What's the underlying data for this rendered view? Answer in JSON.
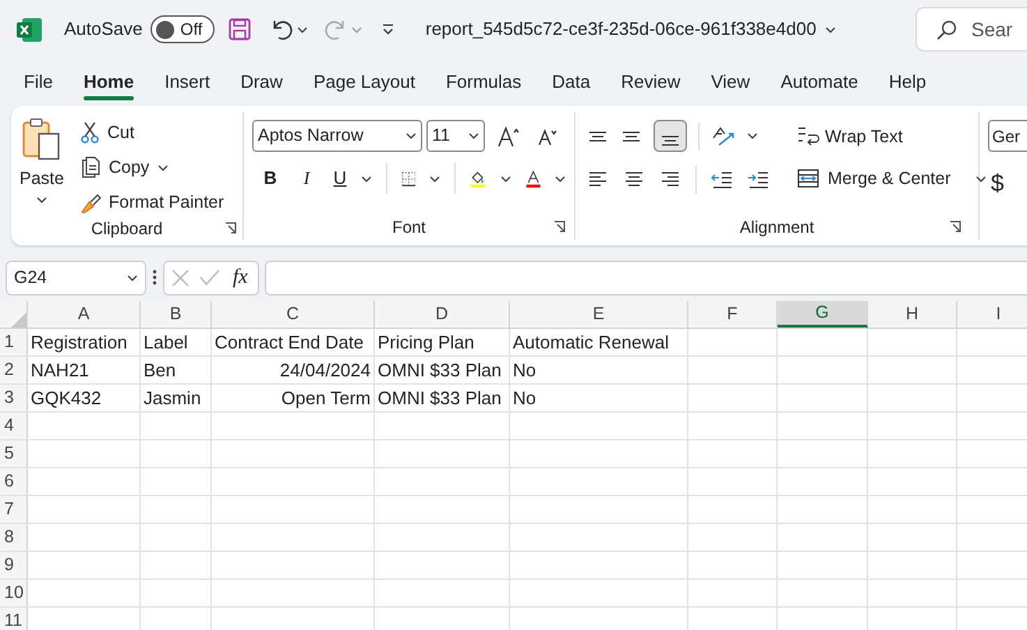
{
  "title_bar": {
    "autosave_label": "AutoSave",
    "autosave_toggle": {
      "label": "Off",
      "on": false
    },
    "file_name": "report_545d5c72-ce3f-235d-06ce-961f338e4d00",
    "search_placeholder": "Sear"
  },
  "menu_tabs": [
    {
      "label": "File",
      "selected": false
    },
    {
      "label": "Home",
      "selected": true
    },
    {
      "label": "Insert",
      "selected": false
    },
    {
      "label": "Draw",
      "selected": false
    },
    {
      "label": "Page Layout",
      "selected": false
    },
    {
      "label": "Formulas",
      "selected": false
    },
    {
      "label": "Data",
      "selected": false
    },
    {
      "label": "Review",
      "selected": false
    },
    {
      "label": "View",
      "selected": false
    },
    {
      "label": "Automate",
      "selected": false
    },
    {
      "label": "Help",
      "selected": false
    }
  ],
  "ribbon": {
    "clipboard": {
      "paste": "Paste",
      "cut": "Cut",
      "copy": "Copy",
      "format_painter": "Format Painter",
      "label": "Clipboard"
    },
    "font": {
      "font_name": "Aptos Narrow",
      "font_size": "11",
      "bold": "B",
      "italic": "I",
      "underline": "U",
      "label": "Font"
    },
    "alignment": {
      "bottom_align_selected": true,
      "wrap_text": "Wrap Text",
      "merge_center": "Merge & Center",
      "label": "Alignment"
    },
    "number": {
      "format": "Ger",
      "currency": "$"
    }
  },
  "formula_bar": {
    "name_box": "G24",
    "fx": "fx"
  },
  "sheet": {
    "columns": [
      {
        "label": "A",
        "selected": false
      },
      {
        "label": "B",
        "selected": false
      },
      {
        "label": "C",
        "selected": false
      },
      {
        "label": "D",
        "selected": false
      },
      {
        "label": "E",
        "selected": false
      },
      {
        "label": "F",
        "selected": false
      },
      {
        "label": "G",
        "selected": true
      },
      {
        "label": "H",
        "selected": false
      },
      {
        "label": "I",
        "selected": false
      }
    ],
    "rows": [
      {
        "label": "1",
        "cells": [
          {
            "text": "Registration"
          },
          {
            "text": "Label"
          },
          {
            "text": "Contract End Date"
          },
          {
            "text": "Pricing Plan"
          },
          {
            "text": "Automatic Renewal"
          }
        ]
      },
      {
        "label": "2",
        "cells": [
          {
            "text": "NAH21",
            "right_aligned": false
          },
          {
            "text": "Ben",
            "right_aligned": false
          },
          {
            "text": "24/04/2024",
            "right_aligned": true
          },
          {
            "text": "OMNI $33 Plan",
            "right_aligned": false
          },
          {
            "text": "No",
            "right_aligned": false
          }
        ]
      },
      {
        "label": "3",
        "cells": [
          {
            "text": "GQK432",
            "right_aligned": false
          },
          {
            "text": "Jasmin",
            "right_aligned": false
          },
          {
            "text": "Open Term",
            "right_aligned": true
          },
          {
            "text": "OMNI $33 Plan",
            "right_aligned": false
          },
          {
            "text": "No",
            "right_aligned": false
          }
        ]
      },
      {
        "label": "4",
        "cells": []
      },
      {
        "label": "5",
        "cells": []
      },
      {
        "label": "6",
        "cells": []
      },
      {
        "label": "7",
        "cells": []
      },
      {
        "label": "8",
        "cells": []
      },
      {
        "label": "9",
        "cells": []
      },
      {
        "label": "10",
        "cells": []
      },
      {
        "label": "11",
        "cells": []
      }
    ]
  }
}
